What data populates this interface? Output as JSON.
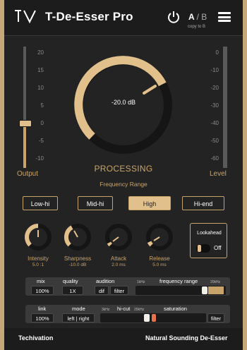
{
  "header": {
    "title": "T-De-Esser Pro",
    "ab_a": "A",
    "ab_sep": "/",
    "ab_b": "B",
    "copy_label": "copy to B"
  },
  "output": {
    "label": "Output",
    "scale": [
      "20",
      "15",
      "10",
      "5",
      "0",
      "-5",
      "-10"
    ],
    "level_fraction": 0.38
  },
  "level": {
    "label": "Level",
    "scale": [
      "0",
      "-10",
      "-20",
      "-30",
      "-40",
      "-50",
      "-60"
    ]
  },
  "processing": {
    "readout": "-20.0 dB",
    "label": "PROCESSING",
    "frequency_range_label": "Frequency Range"
  },
  "frequency_buttons": [
    {
      "label": "Low-hi",
      "active": false
    },
    {
      "label": "Mid-hi",
      "active": false
    },
    {
      "label": "High",
      "active": true
    },
    {
      "label": "Hi-end",
      "active": false
    }
  ],
  "knobs": [
    {
      "label": "Intensity",
      "value": "5.0 :1",
      "fill": 0.5
    },
    {
      "label": "Sharpness",
      "value": "-10.0 dB",
      "fill": 0.42
    },
    {
      "label": "Attack",
      "value": "2.0 ms",
      "fill": 0.06
    },
    {
      "label": "Release",
      "value": "5.0 ms",
      "fill": 0.08
    }
  ],
  "lookahead": {
    "label": "Lookahead",
    "state": "Off"
  },
  "strip1": {
    "mix_label": "mix",
    "mix_value": "100%",
    "quality_label": "quality",
    "quality_value": "1X",
    "audition_label": "audition",
    "dif": "dif",
    "filter": "filter",
    "freq_range_label": "frequency range",
    "freq_low": "1kHz",
    "freq_high": "20kHz"
  },
  "strip2": {
    "link_label": "link",
    "link_value": "100%",
    "mode_label": "mode",
    "mode_value": "left | right",
    "hicut_label": "hi-cut",
    "hicut_low": "3kHz",
    "hicut_high": "20kHz",
    "saturation_label": "saturation",
    "filter": "filter"
  },
  "footer": {
    "brand": "Techivation",
    "tagline": "Natural Sounding De-Esser"
  },
  "colors": {
    "accent": "#c9a46a",
    "highlight": "#e2c08c",
    "marker": "#e8734a",
    "bg": "#232323"
  }
}
